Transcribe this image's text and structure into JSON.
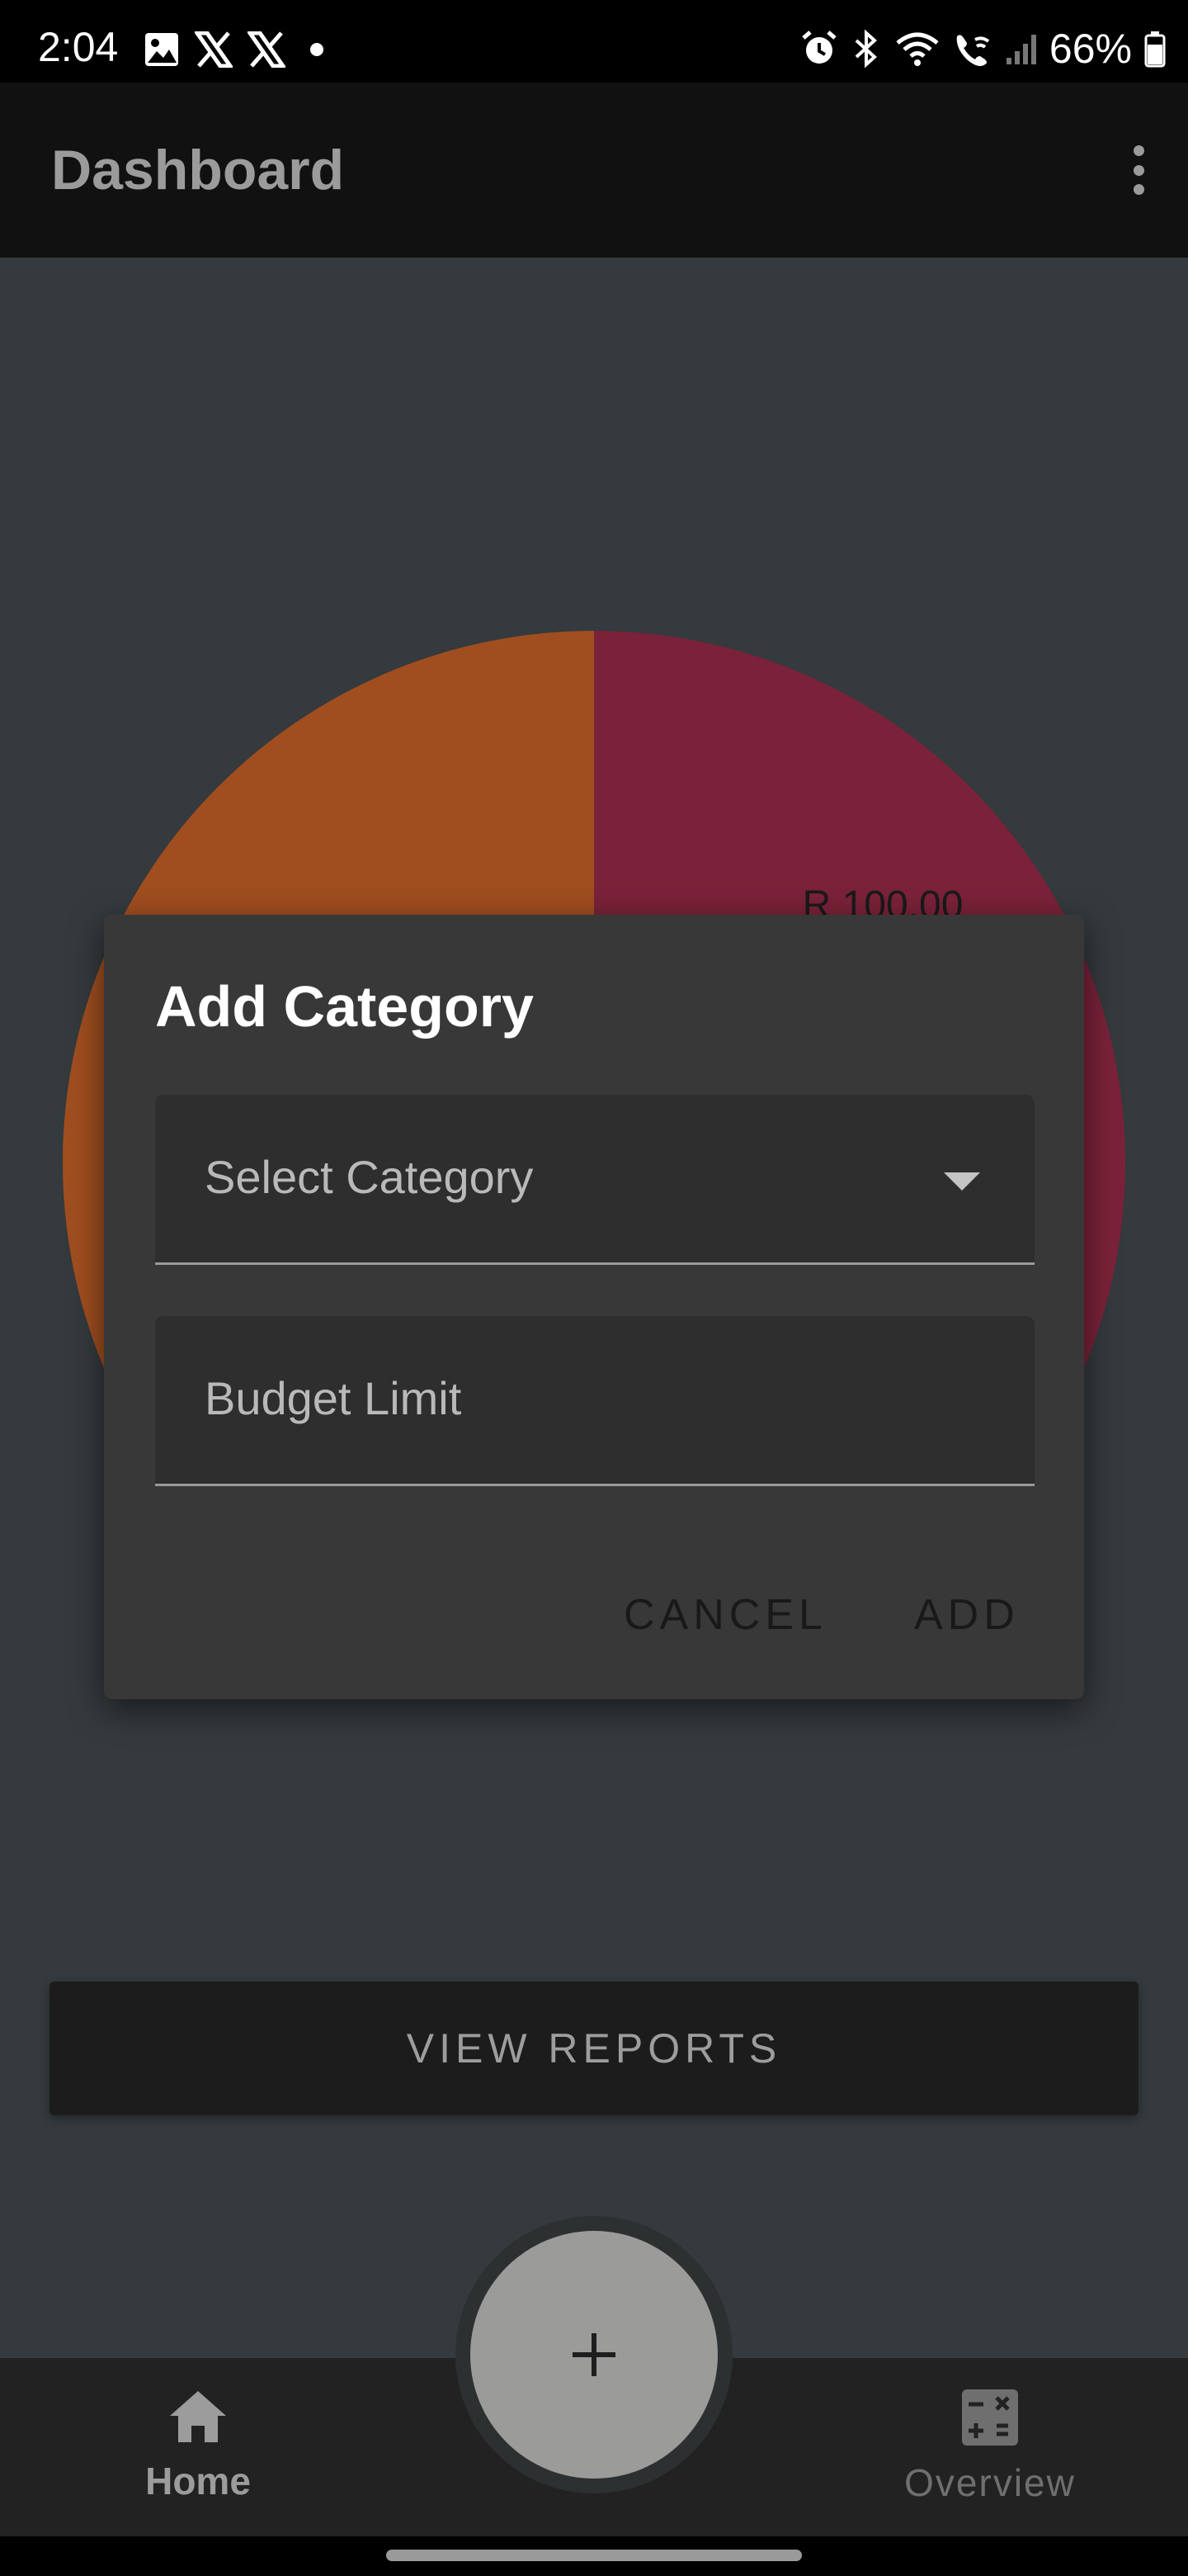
{
  "status_bar": {
    "time": "2:04",
    "battery": "66%",
    "left_icons": [
      "image-icon",
      "x-logo-icon",
      "x-logo-icon",
      "dot-icon"
    ],
    "right_icons": [
      "alarm-icon",
      "bluetooth-icon",
      "wifi-icon",
      "wifi-calling-icon",
      "signal-icon",
      "battery-icon"
    ]
  },
  "app_bar": {
    "title": "Dashboard",
    "menu_icon": "more-vert-icon"
  },
  "chart_data": {
    "type": "pie",
    "slices": [
      {
        "label": "R 100.00",
        "value": 50,
        "color": "#7a2239"
      },
      {
        "label": "",
        "value": 50,
        "color": "#a04e20"
      }
    ]
  },
  "dialog": {
    "title": "Add Category",
    "select_placeholder": "Select Category",
    "budget_placeholder": "Budget Limit",
    "cancel_label": "CANCEL",
    "add_label": "ADD"
  },
  "view_reports_label": "VIEW REPORTS",
  "fab": {
    "icon": "plus-icon"
  },
  "bottom_nav": {
    "items": [
      {
        "label": "Home",
        "icon": "home-icon",
        "active": true
      },
      {
        "label": "Overview",
        "icon": "calculator-icon",
        "active": false
      }
    ]
  },
  "colors": {
    "background": "#343a3d",
    "app_bar": "#111111",
    "dialog": "#383838",
    "pie_red": "#7a2239",
    "pie_orange": "#a04e20"
  }
}
